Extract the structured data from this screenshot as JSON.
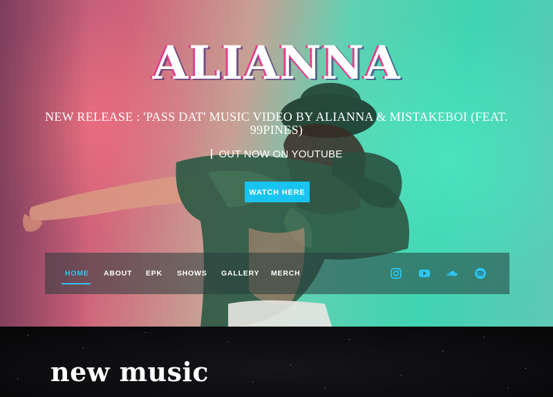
{
  "hero": {
    "title": "ALIANNA",
    "release_text": "NEW RELEASE : 'PASS DAT' MUSIC VIDEO BY ALIANNA & MISTAKEBOI (FEAT. 99PINES)",
    "out_now": "OUT NOW ON YOUTUBE",
    "watch_button": "WATCH HERE"
  },
  "nav": {
    "items": [
      {
        "label": "HOME",
        "active": true
      },
      {
        "label": "ABOUT",
        "active": false
      },
      {
        "label": "EPK",
        "active": false
      },
      {
        "label": "SHOWS",
        "active": false
      },
      {
        "label": "GALLERY",
        "active": false
      },
      {
        "label": "MERCH",
        "active": false
      }
    ],
    "social_icons": [
      "instagram-icon",
      "youtube-icon",
      "soundcloud-icon",
      "spotify-icon"
    ]
  },
  "section": {
    "heading": "new music"
  },
  "colors": {
    "accent": "#19c3f0",
    "nav_active": "#2ec6f0",
    "social_icon": "#2ec6f0"
  }
}
